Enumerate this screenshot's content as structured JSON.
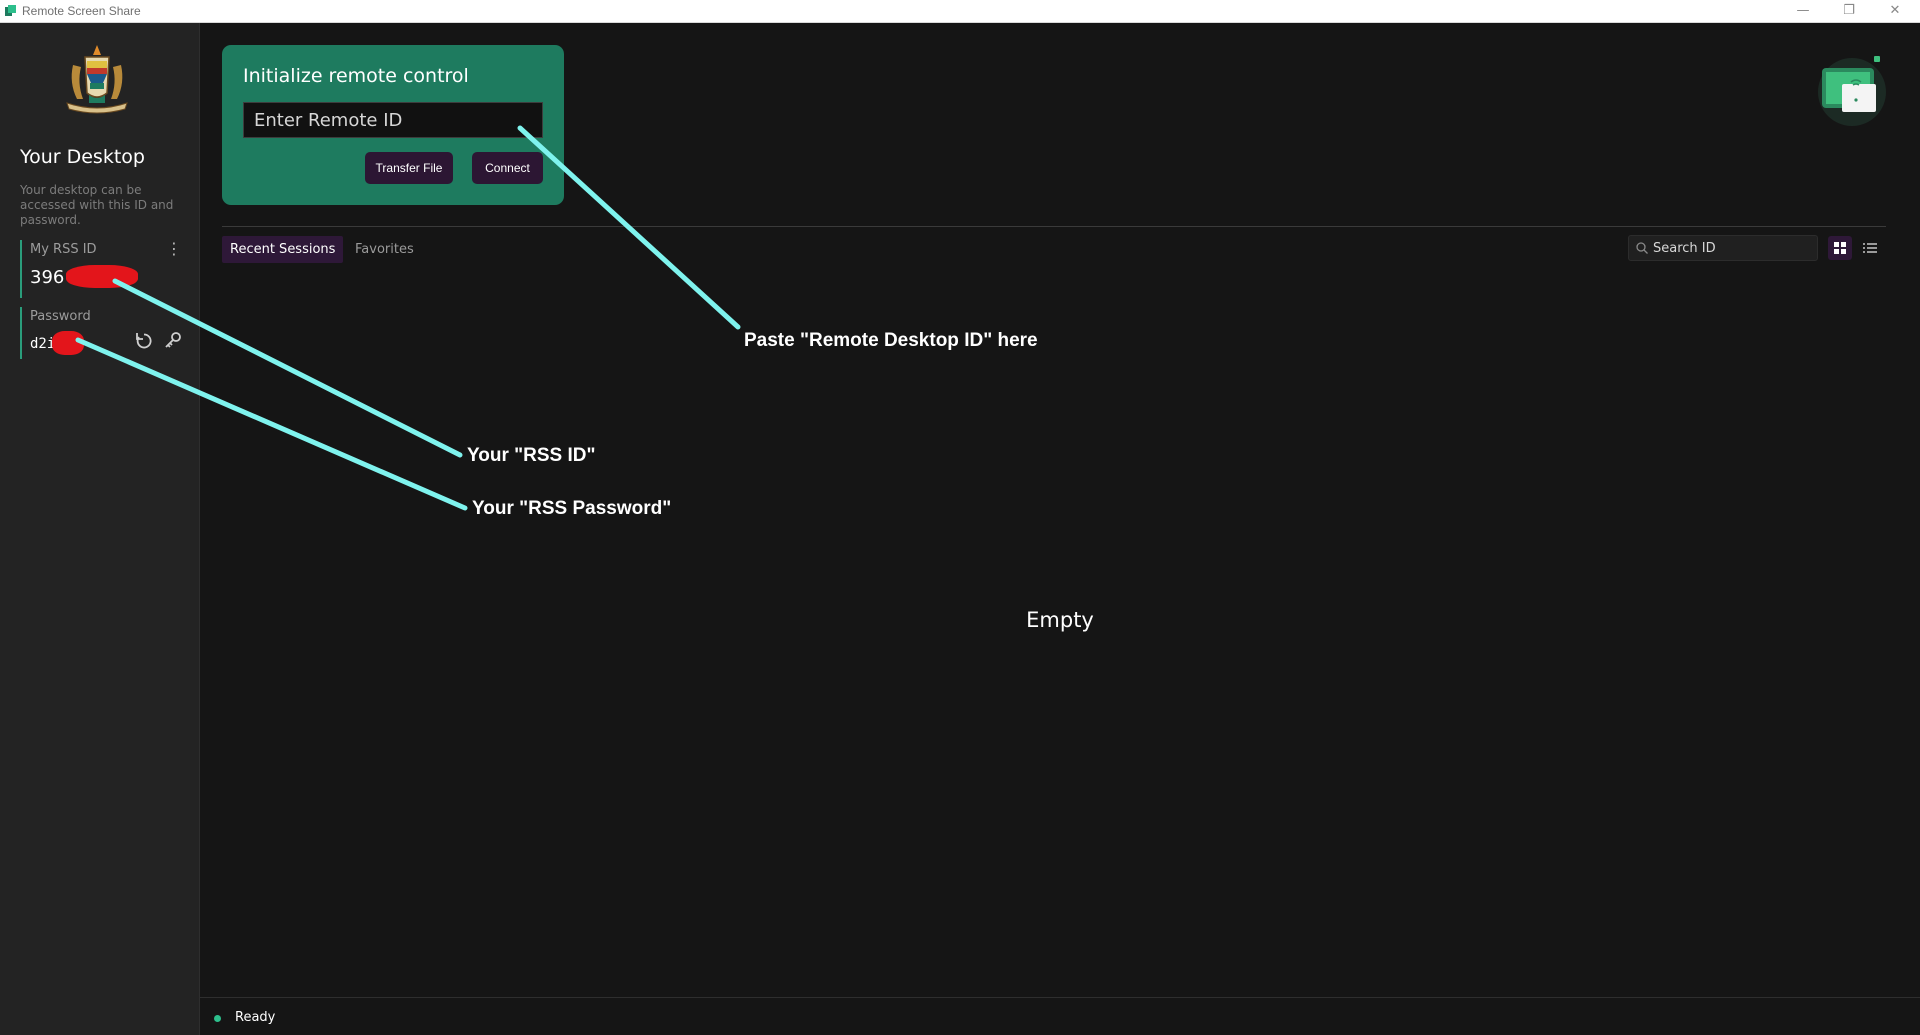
{
  "window": {
    "title": "Remote Screen Share",
    "minimize_glyph": "—",
    "restore_glyph": "❐",
    "close_glyph": "✕"
  },
  "sidebar": {
    "heading": "Your Desktop",
    "help_text": "Your desktop can be accessed with this ID and password.",
    "id_label": "My RSS ID",
    "id_value": "396",
    "menu_glyph": "⋮",
    "password_label": "Password",
    "password_value": "d2i"
  },
  "remote_control": {
    "title": "Initialize remote control",
    "input_placeholder": "Enter Remote ID",
    "transfer_button": "Transfer File",
    "connect_button": "Connect"
  },
  "sessions": {
    "tabs": [
      "Recent Sessions",
      "Favorites"
    ],
    "active_tab": "Recent Sessions",
    "search_placeholder": "Search ID",
    "empty_text": "Empty"
  },
  "status": {
    "text": "Ready",
    "dot_color": "#2dbf8c"
  },
  "annotations": {
    "remote_id": "Paste \"Remote Desktop ID\" here",
    "rss_id": "Your \"RSS ID\"",
    "rss_password": "Your \"RSS Password\""
  },
  "colors": {
    "accent_green": "#1e7b5f",
    "button_purple": "#2c1633",
    "annotation_cyan": "#7ff3ee",
    "redaction_red": "#e3151b"
  },
  "icons": {
    "app": "app-logo-icon",
    "emblem": "coat-of-arms-icon",
    "refresh": "refresh-icon",
    "key": "key-icon",
    "search": "search-icon",
    "grid": "grid-view-icon",
    "list": "list-view-icon"
  }
}
